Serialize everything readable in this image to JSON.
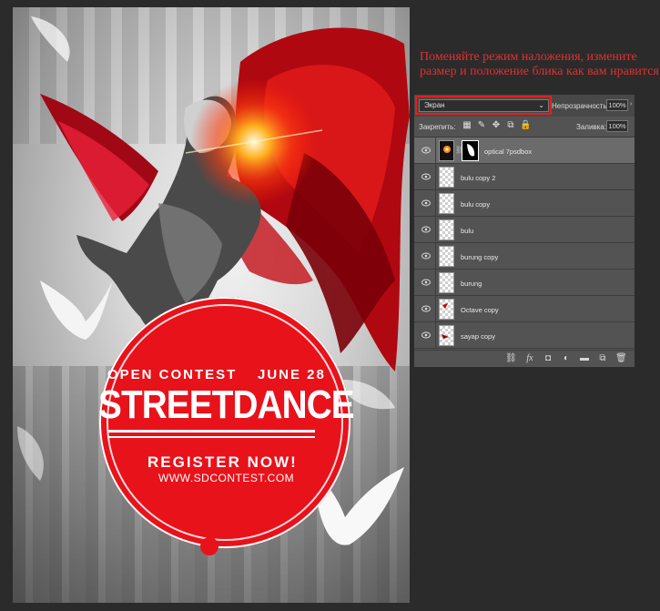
{
  "poster": {
    "open_contest": "OPEN CONTEST",
    "date": "JUNE 28",
    "title": "STREETDANCE",
    "register": "REGISTER NOW!",
    "website": "WWW.SDCONTEST.COM"
  },
  "instruction": "Поменяйте режим наложения, измените размер и положение блика как вам нравится",
  "layers_panel": {
    "blend_mode": "Экран",
    "opacity_label": "Непрозрачность:",
    "opacity_value": "100%",
    "lock_label": "Закрепить:",
    "fill_label": "Заливка:",
    "fill_value": "100%",
    "layers": [
      {
        "name": "optical 7psdbox",
        "selected": true
      },
      {
        "name": "bulu copy 2"
      },
      {
        "name": "bulu copy"
      },
      {
        "name": "bulu"
      },
      {
        "name": "burung copy"
      },
      {
        "name": "burung"
      },
      {
        "name": "Octave copy"
      },
      {
        "name": "sayap copy"
      }
    ],
    "bottom_icons": [
      "link-icon",
      "fx-icon",
      "mask-icon",
      "adjustment-icon",
      "folder-icon",
      "new-layer-icon",
      "trash-icon"
    ]
  },
  "colors": {
    "accent_red": "#e8121b",
    "highlight_red": "#e0201d",
    "panel_bg": "#535353",
    "page_bg": "#2b2b2b"
  }
}
